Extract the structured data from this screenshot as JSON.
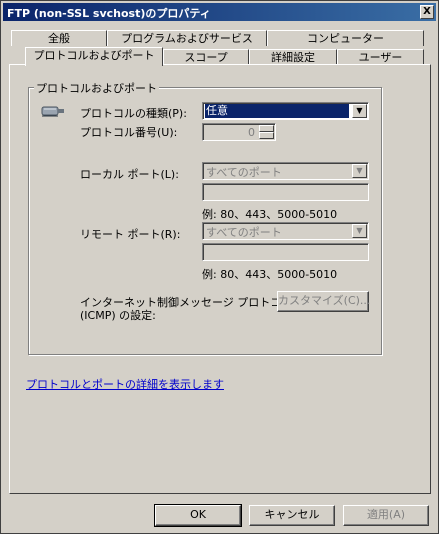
{
  "window": {
    "title": "FTP (non-SSL svchost)のプロパティ",
    "close_label": "X"
  },
  "tabs_row1": [
    {
      "label": "全般"
    },
    {
      "label": "プログラムおよびサービス"
    },
    {
      "label": "コンピューター"
    }
  ],
  "tabs_row2": [
    {
      "label": "プロトコルおよびポート"
    },
    {
      "label": "スコープ"
    },
    {
      "label": "詳細設定"
    },
    {
      "label": "ユーザー"
    }
  ],
  "group": {
    "title": "プロトコルおよびポート",
    "protocol_type_label": "プロトコルの種類(P):",
    "protocol_type_value": "任意",
    "protocol_number_label": "プロトコル番号(U):",
    "protocol_number_value": "0",
    "local_port_label": "ローカル ポート(L):",
    "local_port_value": "すべてのポート",
    "local_example": "例: 80、443、5000-5010",
    "remote_port_label": "リモート ポート(R):",
    "remote_port_value": "すべてのポート",
    "remote_example": "例: 80、443、5000-5010",
    "icmp_label_line1": "インターネット制御メッセージ プロトコル",
    "icmp_label_line2": "(ICMP) の設定:",
    "customize_label": "カスタマイズ(C)..."
  },
  "link": {
    "details": "プロトコルとポートの詳細を表示します"
  },
  "footer": {
    "ok_label": "OK",
    "cancel_label": "キャンセル",
    "apply_label": "適用(A)"
  },
  "icons": {
    "protocol_icon": "network-plug-icon",
    "dropdown": "chevron-down-icon",
    "close": "close-icon"
  },
  "colors": {
    "titlebar": "#0a246a",
    "face": "#d4d0c8",
    "selection": "#0a246a",
    "link": "#0000cc"
  }
}
